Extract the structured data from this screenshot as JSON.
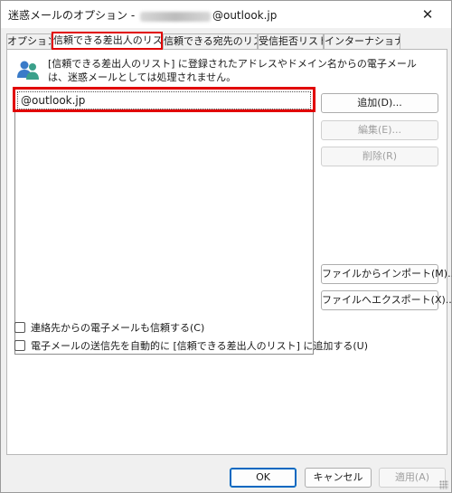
{
  "window": {
    "title_prefix": "迷惑メールのオプション -",
    "title_suffix": "@outlook.jp",
    "close_glyph": "✕"
  },
  "tabs": [
    {
      "label": "オプション",
      "active": false
    },
    {
      "label": "信頼できる差出人のリスト",
      "active": true
    },
    {
      "label": "信頼できる宛先のリスト",
      "active": false
    },
    {
      "label": "受信拒否リスト",
      "active": false
    },
    {
      "label": "インターナショナル",
      "active": false
    }
  ],
  "panel": {
    "description": "[信頼できる差出人のリスト] に登録されたアドレスやドメイン名からの電子メールは、迷惑メールとしては処理されません。",
    "list_items": [
      "@outlook.jp"
    ],
    "buttons": {
      "add": "追加(D)...",
      "edit": "編集(E)...",
      "delete": "削除(R)",
      "import": "ファイルからインポート(M)...",
      "export": "ファイルへエクスポート(X)..."
    },
    "checkboxes": {
      "trust_contacts": {
        "label": "連絡先からの電子メールも信頼する(C)",
        "checked": false
      },
      "auto_add": {
        "label": "電子メールの送信先を自動的に [信頼できる差出人のリスト] に追加する(U)",
        "checked": false
      }
    }
  },
  "footer": {
    "ok": "OK",
    "cancel": "キャンセル",
    "apply": "適用(A)"
  },
  "colors": {
    "highlight": "#e10000",
    "primary_border": "#0067c0"
  }
}
